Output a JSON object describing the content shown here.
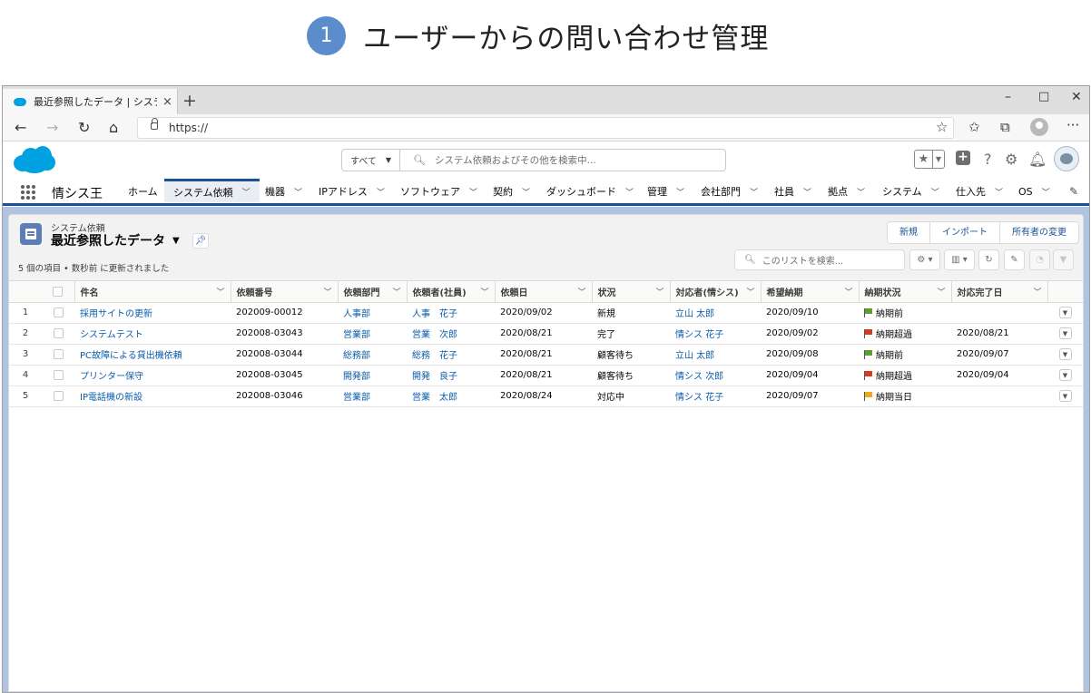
{
  "slide": {
    "step_number": "1",
    "title": "ユーザーからの問い合わせ管理"
  },
  "browser": {
    "tab_title": "最近参照したデータ | システム依頼 |",
    "tab_close": "×",
    "new_tab": "+",
    "minimize": "–",
    "maximize": "□",
    "close": "✕",
    "url": "https://"
  },
  "header": {
    "search_scope": "すべて",
    "search_placeholder": "システム依頼およびその他を検索中..."
  },
  "nav": {
    "app_name": "情シス王",
    "items": [
      {
        "label": "ホーム"
      },
      {
        "label": "システム依頼"
      },
      {
        "label": "機器"
      },
      {
        "label": "IPアドレス"
      },
      {
        "label": "ソフトウェア"
      },
      {
        "label": "契約"
      },
      {
        "label": "ダッシュボード"
      },
      {
        "label": "管理"
      },
      {
        "label": "会社部門"
      },
      {
        "label": "社員"
      },
      {
        "label": "拠点"
      },
      {
        "label": "システム"
      },
      {
        "label": "仕入先"
      },
      {
        "label": "OS"
      }
    ]
  },
  "list": {
    "object_label": "システム依頼",
    "view_name": "最近参照したデータ",
    "info": "5 個の項目 • 数秒前 に更新されました",
    "buttons": {
      "new": "新規",
      "import": "インポート",
      "change_owner": "所有者の変更"
    },
    "search_placeholder": "このリストを検索...",
    "columns": [
      "件名",
      "依頼番号",
      "依頼部門",
      "依頼者(社員)",
      "依頼日",
      "状況",
      "対応者(情シス)",
      "希望納期",
      "納期状況",
      "対応完了日"
    ],
    "rows": [
      {
        "num": "1",
        "subject": "採用サイトの更新",
        "request_no": "202009-00012",
        "dept": "人事部",
        "requester": "人事　花子",
        "date": "2020/09/02",
        "status": "新規",
        "assignee": "立山 太郎",
        "due": "2020/09/10",
        "due_status": "納期前",
        "flag_color": "#5aa02c",
        "done": ""
      },
      {
        "num": "2",
        "subject": "システムテスト",
        "request_no": "202008-03043",
        "dept": "営業部",
        "requester": "営業　次郎",
        "date": "2020/08/21",
        "status": "完了",
        "assignee": "情シス 花子",
        "due": "2020/09/02",
        "due_status": "納期超過",
        "flag_color": "#d9391f",
        "done": "2020/08/21"
      },
      {
        "num": "3",
        "subject": "PC故障による貸出機依頼",
        "request_no": "202008-03044",
        "dept": "総務部",
        "requester": "総務　花子",
        "date": "2020/08/21",
        "status": "顧客待ち",
        "assignee": "立山 太郎",
        "due": "2020/09/08",
        "due_status": "納期前",
        "flag_color": "#5aa02c",
        "done": "2020/09/07"
      },
      {
        "num": "4",
        "subject": "プリンター保守",
        "request_no": "202008-03045",
        "dept": "開発部",
        "requester": "開発　良子",
        "date": "2020/08/21",
        "status": "顧客待ち",
        "assignee": "情シス 次郎",
        "due": "2020/09/04",
        "due_status": "納期超過",
        "flag_color": "#d9391f",
        "done": "2020/09/04"
      },
      {
        "num": "5",
        "subject": "IP電話機の新設",
        "request_no": "202008-03046",
        "dept": "営業部",
        "requester": "営業　太郎",
        "date": "2020/08/24",
        "status": "対応中",
        "assignee": "情シス 花子",
        "due": "2020/09/07",
        "due_status": "納期当日",
        "flag_color": "#f0a81c",
        "done": ""
      }
    ]
  }
}
